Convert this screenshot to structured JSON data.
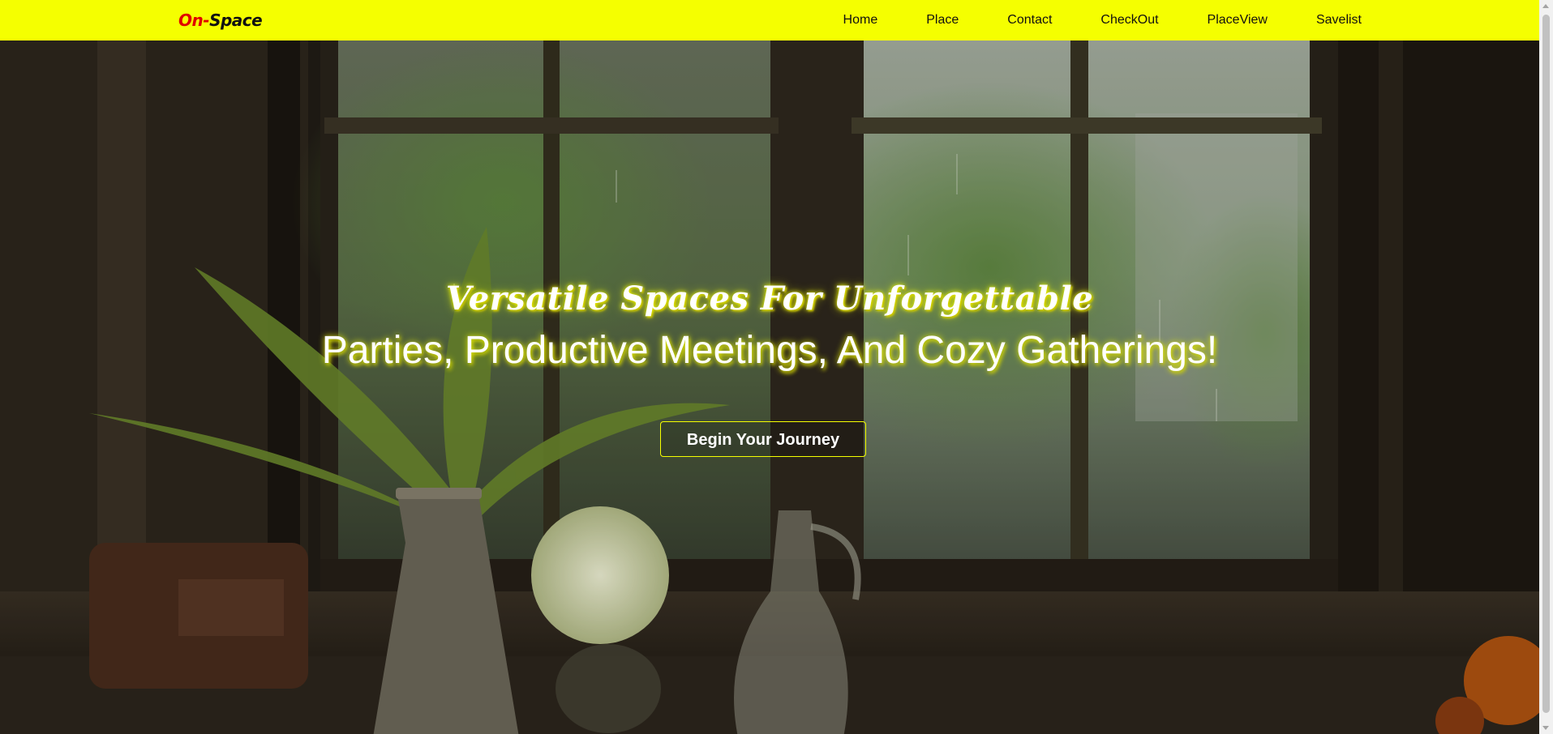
{
  "navbar": {
    "logo": {
      "on": "On",
      "dash": "-",
      "space": "Space"
    },
    "links": [
      "Home",
      "Place",
      "Contact",
      "CheckOut",
      "PlaceView",
      "Savelist"
    ],
    "background": "#f5ff00"
  },
  "hero": {
    "tagline": "Versatile Spaces For Unforgettable",
    "headline": "Parties, Productive Meetings, And Cozy Gatherings!",
    "cta_label": "Begin Your Journey",
    "accent_color": "#f5ff00"
  }
}
